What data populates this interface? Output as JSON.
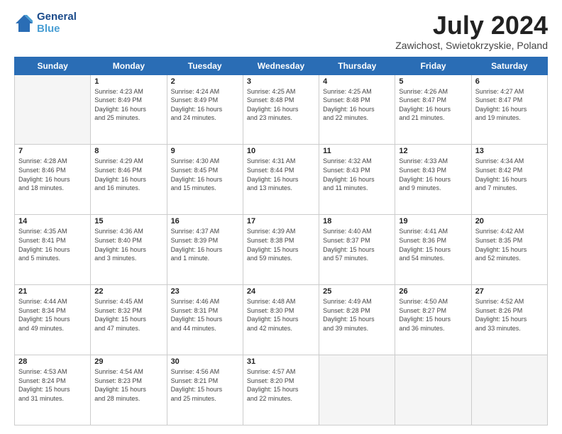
{
  "header": {
    "logo_line1": "General",
    "logo_line2": "Blue",
    "main_title": "July 2024",
    "subtitle": "Zawichost, Swietokrzyskie, Poland"
  },
  "days_of_week": [
    "Sunday",
    "Monday",
    "Tuesday",
    "Wednesday",
    "Thursday",
    "Friday",
    "Saturday"
  ],
  "weeks": [
    [
      {
        "day": "",
        "info": ""
      },
      {
        "day": "1",
        "info": "Sunrise: 4:23 AM\nSunset: 8:49 PM\nDaylight: 16 hours\nand 25 minutes."
      },
      {
        "day": "2",
        "info": "Sunrise: 4:24 AM\nSunset: 8:49 PM\nDaylight: 16 hours\nand 24 minutes."
      },
      {
        "day": "3",
        "info": "Sunrise: 4:25 AM\nSunset: 8:48 PM\nDaylight: 16 hours\nand 23 minutes."
      },
      {
        "day": "4",
        "info": "Sunrise: 4:25 AM\nSunset: 8:48 PM\nDaylight: 16 hours\nand 22 minutes."
      },
      {
        "day": "5",
        "info": "Sunrise: 4:26 AM\nSunset: 8:47 PM\nDaylight: 16 hours\nand 21 minutes."
      },
      {
        "day": "6",
        "info": "Sunrise: 4:27 AM\nSunset: 8:47 PM\nDaylight: 16 hours\nand 19 minutes."
      }
    ],
    [
      {
        "day": "7",
        "info": "Sunrise: 4:28 AM\nSunset: 8:46 PM\nDaylight: 16 hours\nand 18 minutes."
      },
      {
        "day": "8",
        "info": "Sunrise: 4:29 AM\nSunset: 8:46 PM\nDaylight: 16 hours\nand 16 minutes."
      },
      {
        "day": "9",
        "info": "Sunrise: 4:30 AM\nSunset: 8:45 PM\nDaylight: 16 hours\nand 15 minutes."
      },
      {
        "day": "10",
        "info": "Sunrise: 4:31 AM\nSunset: 8:44 PM\nDaylight: 16 hours\nand 13 minutes."
      },
      {
        "day": "11",
        "info": "Sunrise: 4:32 AM\nSunset: 8:43 PM\nDaylight: 16 hours\nand 11 minutes."
      },
      {
        "day": "12",
        "info": "Sunrise: 4:33 AM\nSunset: 8:43 PM\nDaylight: 16 hours\nand 9 minutes."
      },
      {
        "day": "13",
        "info": "Sunrise: 4:34 AM\nSunset: 8:42 PM\nDaylight: 16 hours\nand 7 minutes."
      }
    ],
    [
      {
        "day": "14",
        "info": "Sunrise: 4:35 AM\nSunset: 8:41 PM\nDaylight: 16 hours\nand 5 minutes."
      },
      {
        "day": "15",
        "info": "Sunrise: 4:36 AM\nSunset: 8:40 PM\nDaylight: 16 hours\nand 3 minutes."
      },
      {
        "day": "16",
        "info": "Sunrise: 4:37 AM\nSunset: 8:39 PM\nDaylight: 16 hours\nand 1 minute."
      },
      {
        "day": "17",
        "info": "Sunrise: 4:39 AM\nSunset: 8:38 PM\nDaylight: 15 hours\nand 59 minutes."
      },
      {
        "day": "18",
        "info": "Sunrise: 4:40 AM\nSunset: 8:37 PM\nDaylight: 15 hours\nand 57 minutes."
      },
      {
        "day": "19",
        "info": "Sunrise: 4:41 AM\nSunset: 8:36 PM\nDaylight: 15 hours\nand 54 minutes."
      },
      {
        "day": "20",
        "info": "Sunrise: 4:42 AM\nSunset: 8:35 PM\nDaylight: 15 hours\nand 52 minutes."
      }
    ],
    [
      {
        "day": "21",
        "info": "Sunrise: 4:44 AM\nSunset: 8:34 PM\nDaylight: 15 hours\nand 49 minutes."
      },
      {
        "day": "22",
        "info": "Sunrise: 4:45 AM\nSunset: 8:32 PM\nDaylight: 15 hours\nand 47 minutes."
      },
      {
        "day": "23",
        "info": "Sunrise: 4:46 AM\nSunset: 8:31 PM\nDaylight: 15 hours\nand 44 minutes."
      },
      {
        "day": "24",
        "info": "Sunrise: 4:48 AM\nSunset: 8:30 PM\nDaylight: 15 hours\nand 42 minutes."
      },
      {
        "day": "25",
        "info": "Sunrise: 4:49 AM\nSunset: 8:28 PM\nDaylight: 15 hours\nand 39 minutes."
      },
      {
        "day": "26",
        "info": "Sunrise: 4:50 AM\nSunset: 8:27 PM\nDaylight: 15 hours\nand 36 minutes."
      },
      {
        "day": "27",
        "info": "Sunrise: 4:52 AM\nSunset: 8:26 PM\nDaylight: 15 hours\nand 33 minutes."
      }
    ],
    [
      {
        "day": "28",
        "info": "Sunrise: 4:53 AM\nSunset: 8:24 PM\nDaylight: 15 hours\nand 31 minutes."
      },
      {
        "day": "29",
        "info": "Sunrise: 4:54 AM\nSunset: 8:23 PM\nDaylight: 15 hours\nand 28 minutes."
      },
      {
        "day": "30",
        "info": "Sunrise: 4:56 AM\nSunset: 8:21 PM\nDaylight: 15 hours\nand 25 minutes."
      },
      {
        "day": "31",
        "info": "Sunrise: 4:57 AM\nSunset: 8:20 PM\nDaylight: 15 hours\nand 22 minutes."
      },
      {
        "day": "",
        "info": ""
      },
      {
        "day": "",
        "info": ""
      },
      {
        "day": "",
        "info": ""
      }
    ]
  ]
}
